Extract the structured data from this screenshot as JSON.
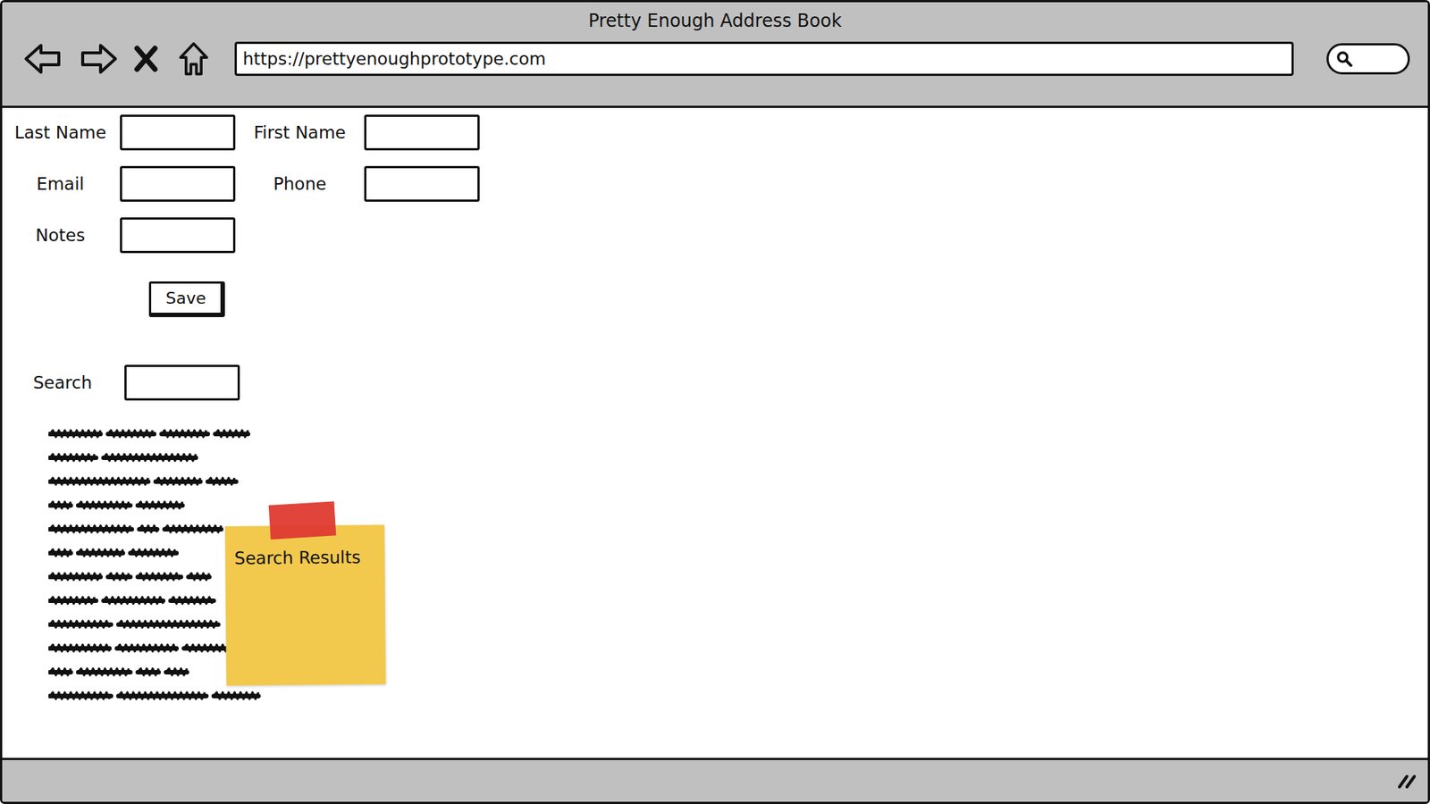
{
  "window": {
    "title": "Pretty Enough Address Book"
  },
  "browser": {
    "url": "https://prettyenoughprototype.com"
  },
  "form": {
    "fields": [
      {
        "label": "Last Name",
        "value": ""
      },
      {
        "label": "First Name",
        "value": ""
      },
      {
        "label": "Email",
        "value": ""
      },
      {
        "label": "Phone",
        "value": ""
      },
      {
        "label": "Notes",
        "value": ""
      }
    ],
    "save_button": "Save"
  },
  "search": {
    "label": "Search",
    "value": ""
  },
  "sticky_note": {
    "text": "Search Results"
  }
}
